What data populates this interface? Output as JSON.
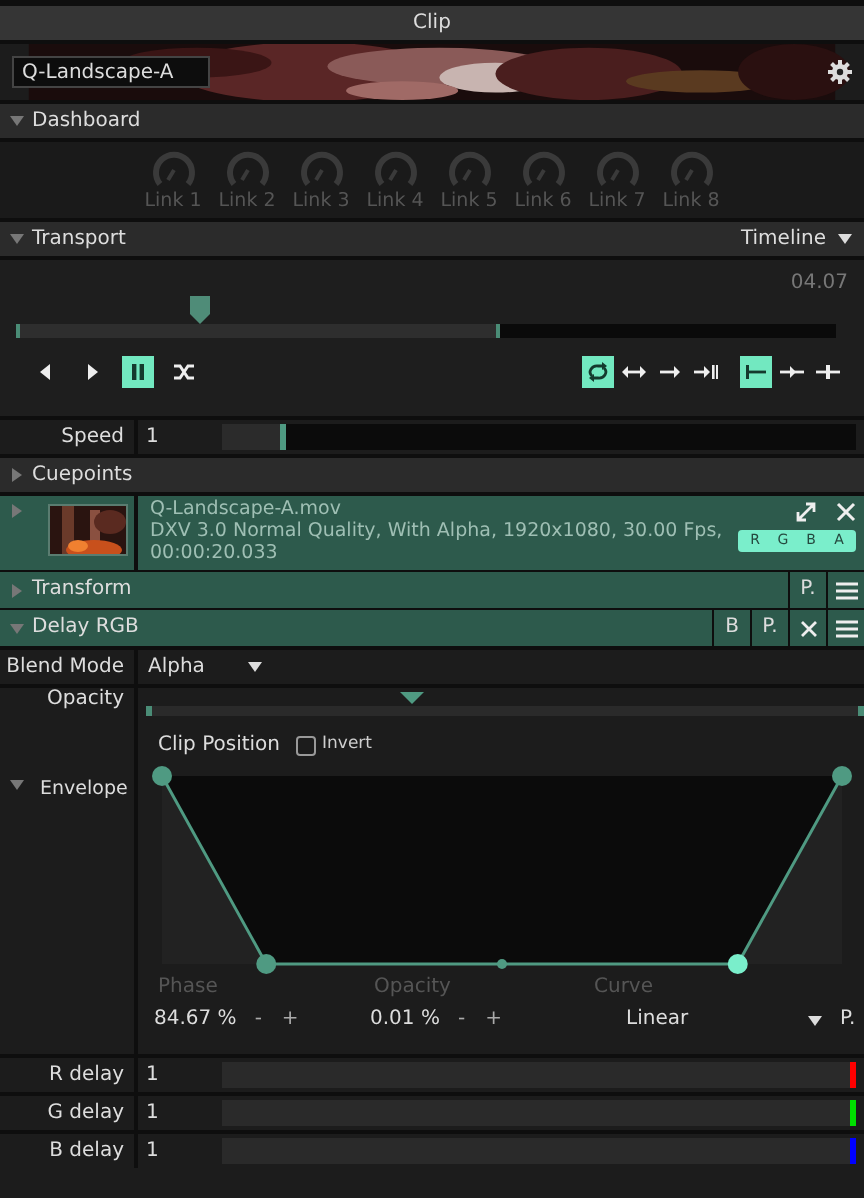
{
  "window": {
    "title": "Clip"
  },
  "clip": {
    "name": "Q-Landscape-A"
  },
  "dashboard": {
    "title": "Dashboard",
    "expanded": true,
    "links": [
      "Link 1",
      "Link 2",
      "Link 3",
      "Link 4",
      "Link 5",
      "Link 6",
      "Link 7",
      "Link 8"
    ]
  },
  "transport": {
    "title": "Transport",
    "expanded": true,
    "mode": "Timeline",
    "time": "04.07",
    "playhead": {
      "level": 0.22
    },
    "range": {
      "level": 0.59
    },
    "play_buttons": [
      {
        "kind": "reverse",
        "selected": false
      },
      {
        "kind": "play",
        "selected": false
      },
      {
        "kind": "pause",
        "selected": true
      },
      {
        "kind": "random",
        "selected": false
      }
    ],
    "loop_buttons": [
      {
        "kind": "loop",
        "selected": true
      },
      {
        "kind": "bounce",
        "selected": false
      },
      {
        "kind": "once",
        "selected": false
      },
      {
        "kind": "once-hold",
        "selected": false
      }
    ],
    "trigger_buttons": [
      {
        "kind": "restart",
        "selected": true
      },
      {
        "kind": "continue",
        "selected": false
      },
      {
        "kind": "sync",
        "selected": false
      }
    ]
  },
  "speed": {
    "label": "Speed",
    "value": "1",
    "level": 0.1
  },
  "cuepoints": {
    "title": "Cuepoints",
    "expanded": false
  },
  "media": {
    "file": "Q-Landscape-A.mov",
    "info": "DXV 3.0 Normal Quality, With Alpha, 1920x1080, 30.00 Fps,",
    "duration": "00:00:20.033",
    "channels": [
      {
        "label": "R",
        "on": true
      },
      {
        "label": "G",
        "on": true
      },
      {
        "label": "B",
        "on": true
      },
      {
        "label": "A",
        "on": true
      }
    ]
  },
  "effects": [
    {
      "title": "Transform",
      "expanded": false,
      "closable": false,
      "buttons": [
        "P."
      ]
    },
    {
      "title": "Delay RGB",
      "expanded": true,
      "closable": true,
      "buttons": [
        "B",
        "P."
      ]
    }
  ],
  "blend_mode": {
    "label": "Blend Mode",
    "value": "Alpha"
  },
  "opacity": {
    "label": "Opacity",
    "level": 0.37
  },
  "envelope": {
    "label": "Envelope",
    "expanded": true,
    "source": "Clip Position",
    "invert": {
      "label": "Invert",
      "checked": false
    },
    "params": [
      {
        "label": "Phase",
        "value": "84.67 %",
        "level": 0.8467,
        "steppers": [
          "-",
          "+"
        ]
      },
      {
        "label": "Opacity",
        "value": "0.01 %",
        "steppers": [
          "-",
          "+"
        ]
      },
      {
        "label": "Curve",
        "value": "Linear"
      }
    ],
    "preset_button": "P."
  },
  "delays": [
    {
      "label": "R delay",
      "value": "1",
      "color": "#ff0000",
      "level": 1
    },
    {
      "label": "G delay",
      "value": "1",
      "color": "#00e000",
      "level": 1
    },
    {
      "label": "B delay",
      "value": "1",
      "color": "#0000ff",
      "level": 1
    }
  ]
}
